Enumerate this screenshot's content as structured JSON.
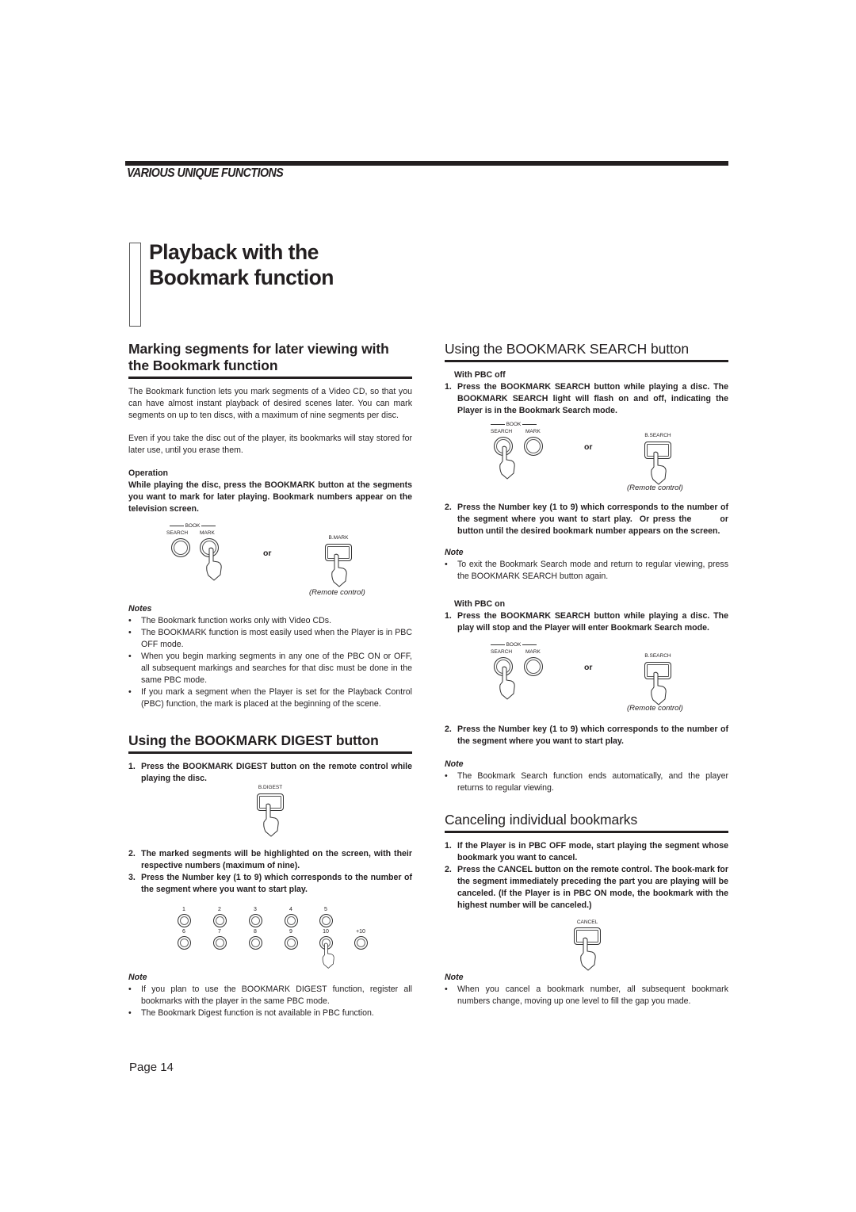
{
  "header": {
    "section_tag": "VARIOUS UNIQUE FUNCTIONS",
    "title_line1": "Playback with the",
    "title_line2": "Bookmark function"
  },
  "marking": {
    "heading": "Marking segments for later viewing with the Bookmark function",
    "para1": "The Bookmark function lets you mark segments of a Video CD, so that you can have almost instant playback of desired scenes later.  You can mark segments on up to ten discs, with a maximum of nine segments per disc.",
    "para2": "Even if you take the disc out of the player, its bookmarks will stay stored for later use, until you erase them.",
    "operation_label": "Operation",
    "operation_text": "While playing the disc, press the BOOKMARK button at the segments you want to mark for later playing.  Bookmark numbers appear on the television screen.",
    "illustration": {
      "group_label": "BOOK",
      "search_label": "SEARCH",
      "mark_label": "MARK",
      "or": "or",
      "remote_button": "B.MARK",
      "caption": "(Remote control)"
    },
    "notes_title": "Notes",
    "notes": [
      "The Bookmark function works only with Video CDs.",
      "The BOOKMARK function is most easily used when the Player is in PBC OFF mode.",
      "When you begin marking segments in any one of the PBC ON or OFF, all subsequent markings and searches for that disc must be done in the same PBC mode.",
      "If you mark a segment when the Player is set for the Playback Control (PBC) function, the mark is placed at the beginning of the scene."
    ]
  },
  "digest": {
    "heading": "Using the BOOKMARK DIGEST button",
    "step1": "Press the BOOKMARK DIGEST button on the remote control while playing the disc.",
    "remote_button": "B.DIGEST",
    "step2": "The marked segments will be highlighted on the screen, with their respective numbers (maximum of nine).",
    "step3": "Press the Number key (1 to 9) which corresponds to the number of the segment where you want to start play.",
    "keys_row1": [
      "1",
      "2",
      "3",
      "4",
      "5"
    ],
    "keys_row2": [
      "6",
      "7",
      "8",
      "9",
      "10",
      "+10"
    ],
    "note_title": "Note",
    "notes": [
      "If you plan to use the BOOKMARK DIGEST function, register all bookmarks with the player in the same PBC mode.",
      "The Bookmark Digest function is not available in PBC function."
    ]
  },
  "search": {
    "heading": "Using the BOOKMARK SEARCH button",
    "pbc_off_label": "With PBC off",
    "off_step1": "Press the BOOKMARK SEARCH button while playing a disc. The BOOKMARK SEARCH light will flash on and off, indicating the Player is in the Bookmark Search mode.",
    "illustration": {
      "group_label": "BOOK",
      "search_label": "SEARCH",
      "mark_label": "MARK",
      "or": "or",
      "remote_button": "B.SEARCH",
      "caption": "(Remote control)"
    },
    "off_step2": "Press the Number key (1 to 9) which corresponds to the number of the segment where you want to start play.  Or press the        or          button until the desired bookmark number appears on the screen.",
    "off_note_title": "Note",
    "off_notes": [
      "To exit the Bookmark Search mode and return to regular viewing, press the BOOKMARK SEARCH button again."
    ],
    "pbc_on_label": "With PBC on",
    "on_step1": "Press the BOOKMARK SEARCH button while playing a disc. The play will stop and the Player will enter Bookmark Search mode.",
    "on_step2": "Press the Number key (1 to 9) which corresponds to the number of the segment where you want to start play.",
    "on_note_title": "Note",
    "on_notes": [
      "The Bookmark Search function ends automatically, and the player returns to regular viewing."
    ]
  },
  "cancel": {
    "heading": "Canceling individual bookmarks",
    "step1": "If the Player is in PBC OFF mode, start playing the segment whose bookmark you want to cancel.",
    "step2": "Press the CANCEL button on the remote control.  The book-mark for the segment immediately preceding the part you are playing will be canceled.  (If the Player is in PBC ON mode, the bookmark with the highest number will be canceled.)",
    "remote_button": "CANCEL",
    "note_title": "Note",
    "notes": [
      "When you cancel a bookmark number, all subsequent bookmark numbers change, moving up one level to fill the gap you made."
    ]
  },
  "footer": {
    "page": "Page 14"
  },
  "list_marks": {
    "bullet": "•",
    "n1": "1.",
    "n2": "2.",
    "n3": "3."
  }
}
